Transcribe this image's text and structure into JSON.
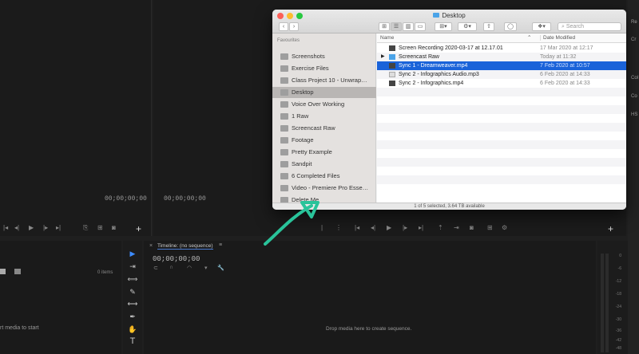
{
  "premiere": {
    "source_timecode": "00;00;00;00",
    "program_timecode": "00;00;00;00",
    "project_items_count": "0 items",
    "project_drop_hint": "rt media to start",
    "timeline_title": "Timeline: (no sequence)",
    "timeline_timecode": "00;00;00;00",
    "timeline_drop_hint": "Drop media here to create sequence.",
    "add_label": "+",
    "right_panel_labels": [
      "Re",
      "Cr",
      "Col",
      "Co",
      "HS",
      "Vi"
    ],
    "meter_ticks": [
      "0",
      "-6",
      "-12",
      "-18",
      "-24",
      "-30",
      "-36",
      "-42",
      "-48",
      "-54"
    ]
  },
  "finder": {
    "title": "Desktop",
    "search_placeholder": "Search",
    "sidebar_header": "Favourites",
    "sidebar_items": [
      "Screenshots",
      "Exercise Files",
      "Class Project 10 - Unwrap…",
      "Desktop",
      "Voice Over Working",
      "1 Raw",
      "Screencast Raw",
      "Footage",
      "Pretty Example",
      "Sandpit",
      "6 Completed Files",
      "Video - Premiere Pro Esse…",
      "Delete Me"
    ],
    "selected_sidebar_index": 3,
    "columns": {
      "name": "Name",
      "date": "Date Modified"
    },
    "files": [
      {
        "name": "Screen Recording 2020-03-17 at 12.17.01",
        "date": "17 Mar 2020 at 12:17"
      },
      {
        "name": "Screencast Raw",
        "date": "Today at 11:32"
      },
      {
        "name": "Sync 1 - Dreamweaver.mp4",
        "date": "7 Feb 2020 at 10:57"
      },
      {
        "name": "Sync 2 - Infographics Audio.mp3",
        "date": "6 Feb 2020 at 14:33"
      },
      {
        "name": "Sync 2 - Infographics.mp4",
        "date": "6 Feb 2020 at 14:33"
      }
    ],
    "selected_file_index": 2,
    "status": "1 of 5 selected, 3.64 TB available"
  },
  "colors": {
    "selection": "#1a63d9",
    "arrow": "#29c39a",
    "folder": "#4aa3e8"
  }
}
